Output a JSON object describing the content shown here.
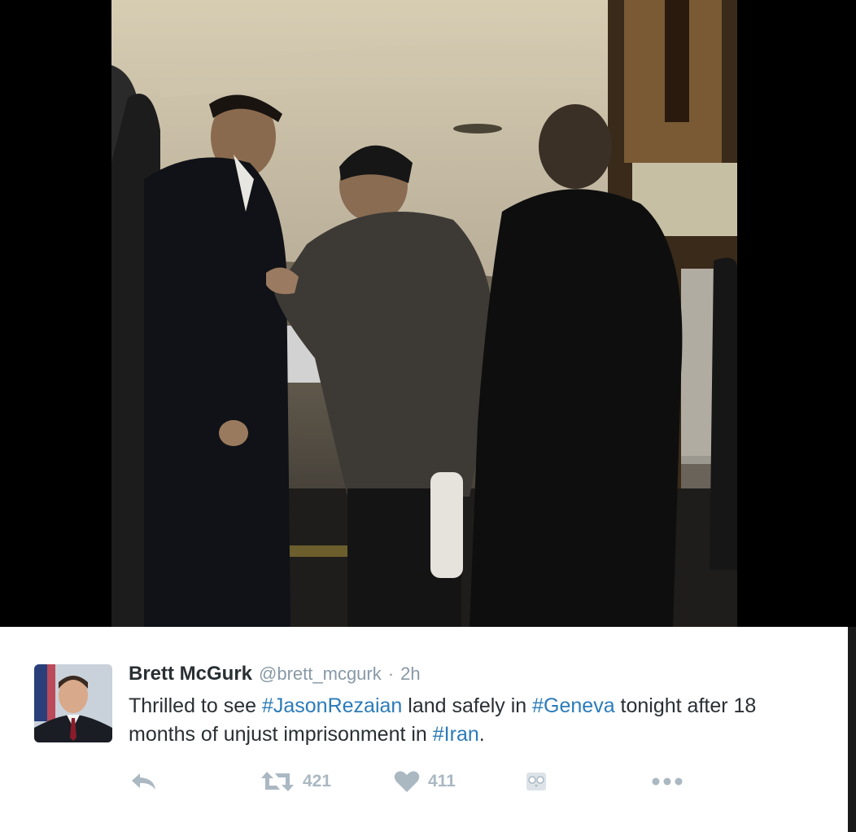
{
  "tweet": {
    "display_name": "Brett McGurk",
    "handle": "@brett_mcgurk",
    "separator": "·",
    "time": "2h",
    "text_parts": {
      "p1": "Thrilled to see ",
      "h1": "#JasonRezaian",
      "p2": " land safely in ",
      "h2": "#Geneva",
      "p3": " tonight after 18 months of unjust imprisonment in ",
      "h3": "#Iran",
      "p4": "."
    },
    "retweet_count": "421",
    "like_count": "411"
  },
  "icons": {
    "reply": "reply-icon",
    "retweet": "retweet-icon",
    "like": "heart-icon",
    "archive": "owl-icon",
    "more": "more-icon"
  },
  "colors": {
    "hashtag": "#2b7bb9",
    "muted": "#8899a6",
    "action": "#aab8c2",
    "text": "#292f33"
  }
}
